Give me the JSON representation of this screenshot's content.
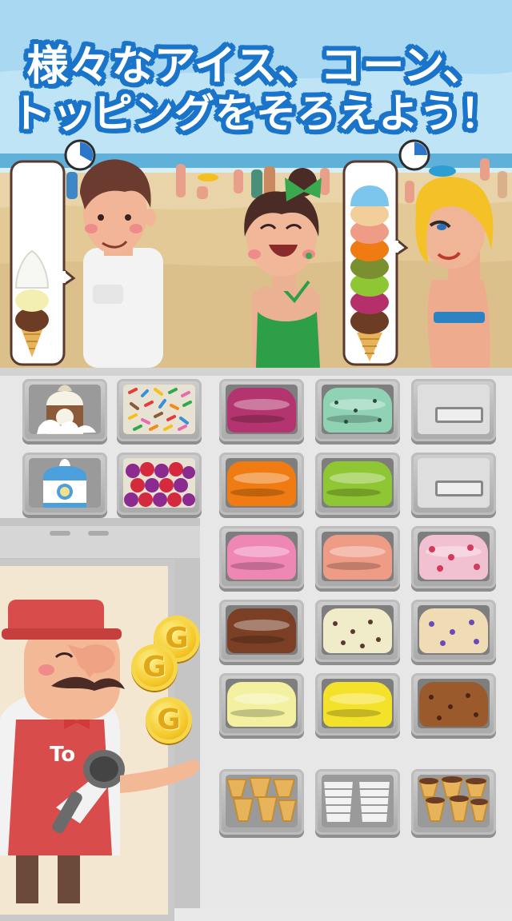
{
  "promo": {
    "line1": "様々なアイス、コーン、",
    "line2": "トッピングをそろえよう！"
  },
  "colors": {
    "headline_fill": "#ffffff",
    "headline_outline": "#1a74c9",
    "sky": "#a9d8f2",
    "sand": "#e9d3a8",
    "counter": "#e7e7e7"
  },
  "customers": [
    {
      "name": "man-in-white-shirt",
      "order": [
        "whipped-cream",
        "vanilla",
        "chocolate",
        "cone"
      ],
      "timer": "timer-icon"
    },
    {
      "name": "woman-in-green-dress",
      "order": [],
      "timer": ""
    },
    {
      "name": "blonde-woman-in-bikini",
      "order": [
        "blue-scoop",
        "peach",
        "orange",
        "green",
        "purple",
        "chocolate",
        "cone"
      ],
      "timer": "timer-icon"
    }
  ],
  "chef": {
    "apron_text": "To",
    "coins": [
      "G",
      "G",
      "G"
    ]
  },
  "toppings": [
    {
      "name": "whipped-cream-bottle",
      "icon": "cream-bottle-icon"
    },
    {
      "name": "sprinkles",
      "icon": "sprinkles-icon"
    },
    {
      "name": "syrup-bottle",
      "icon": "syrup-bottle-icon"
    },
    {
      "name": "berries",
      "icon": "berries-icon"
    }
  ],
  "flavors": [
    {
      "name": "grape",
      "color": "#b3346f"
    },
    {
      "name": "mint-chip",
      "color": "#8fd2b4"
    },
    {
      "name": "empty-1",
      "color": ""
    },
    {
      "name": "orange",
      "color": "#ef7b12"
    },
    {
      "name": "lime",
      "color": "#8fc633"
    },
    {
      "name": "empty-2",
      "color": ""
    },
    {
      "name": "strawberry",
      "color": "#ef87b5"
    },
    {
      "name": "peach",
      "color": "#ef9c86"
    },
    {
      "name": "strawberry-chunk",
      "color": "#f1c0d1"
    },
    {
      "name": "chocolate",
      "color": "#7a3f24"
    },
    {
      "name": "cookies-cream",
      "color": "#f0ebc8"
    },
    {
      "name": "blueberry-ripple",
      "color": "#efdcb4"
    },
    {
      "name": "vanilla",
      "color": "#f3f0a0"
    },
    {
      "name": "lemon",
      "color": "#f4e22a"
    },
    {
      "name": "rocky-road",
      "color": "#9a5a2b"
    }
  ],
  "cones": [
    {
      "name": "waffle-cones",
      "icon": "waffle-cone-icon"
    },
    {
      "name": "paper-cups",
      "icon": "cup-icon"
    },
    {
      "name": "chocolate-cones",
      "icon": "choco-cone-icon"
    }
  ]
}
